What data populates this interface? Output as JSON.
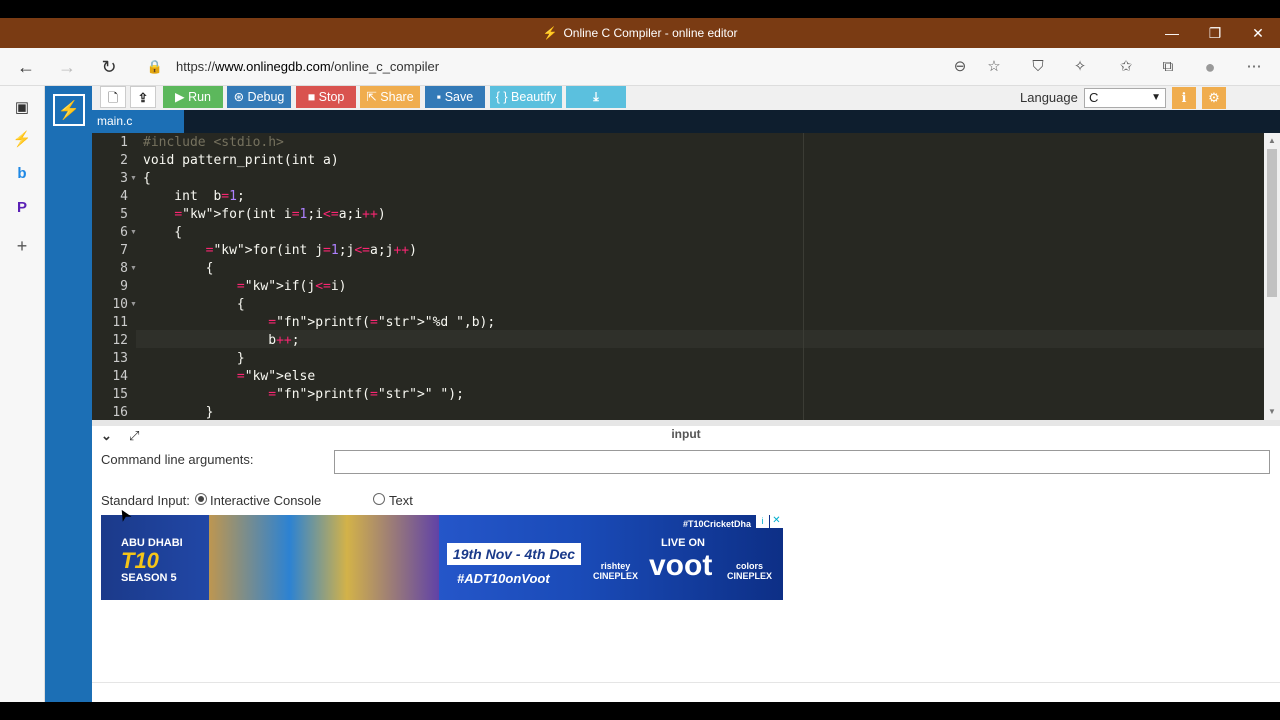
{
  "window": {
    "title": "Online C Compiler - online editor",
    "controls": {
      "minimize": "—",
      "restore": "❐",
      "close": "✕"
    }
  },
  "browser": {
    "url_prefix": "https://",
    "url_host": "www.onlinegdb.com",
    "url_path": "/online_c_compiler"
  },
  "toolbar": {
    "run_label": "Run",
    "debug_label": "Debug",
    "stop_label": "Stop",
    "share_label": "Share",
    "save_label": "Save",
    "beautify_label": "{ } Beautify",
    "language_label": "Language",
    "language_value": "C",
    "colors": {
      "run": "#5cb85c",
      "debug": "#337ab7",
      "stop": "#d9534f",
      "share": "#f0ad4e",
      "save": "#337ab7",
      "beautify": "#5bc0de",
      "download": "#5bc0de"
    }
  },
  "file_tab": {
    "name": "main.c"
  },
  "code": {
    "line_numbers": [
      "1",
      "2",
      "3",
      "4",
      "5",
      "6",
      "7",
      "8",
      "9",
      "10",
      "11",
      "12",
      "13",
      "14",
      "15",
      "16"
    ],
    "lines": [
      "#include <stdio.h>",
      "void pattern_print(int a)",
      "{",
      "    int  b=1;",
      "    for(int i=1;i<=a;i++)",
      "    {",
      "        for(int j=1;j<=a;j++)",
      "        {",
      "            if(j<=i)",
      "            {",
      "                printf(\"%d \",b);",
      "                b++;",
      "            }",
      "            else",
      "                printf(\" \");",
      "        }"
    ]
  },
  "io_panel": {
    "title": "input",
    "cla_label": "Command line arguments:",
    "cla_value": "",
    "stdin_label": "Standard Input:",
    "option_interactive": "Interactive Console",
    "option_text": "Text",
    "selected": "Interactive Console"
  },
  "ad": {
    "left_line1": "ABU DHABI",
    "brand": "T10",
    "season": "SEASON 5",
    "dates": "19th Nov - 4th Dec",
    "hashtag_bottom": "#ADT10onVoot",
    "hashtag_top": "#T10CricketDha",
    "live_on": "LIVE ON",
    "voot": "voot",
    "cineplex1_top": "rishtey",
    "cineplex1": "CINEPLEX",
    "cineplex2_top": "colors",
    "cineplex2": "CINEPLEX"
  }
}
